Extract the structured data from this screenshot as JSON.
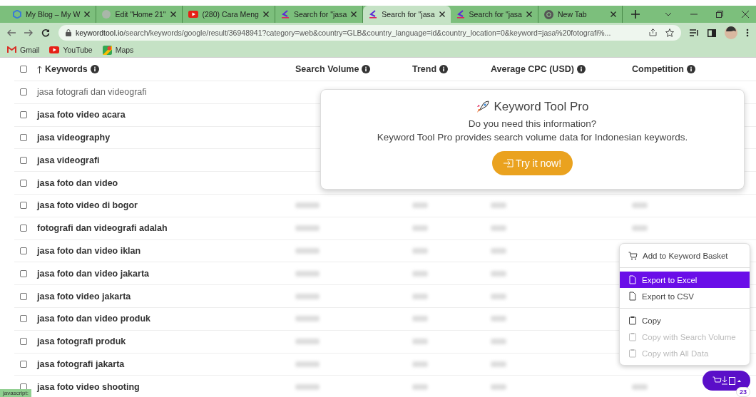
{
  "browser": {
    "tabs": [
      {
        "title": "My Blog – My W",
        "selected": false
      },
      {
        "title": "Edit \"Home 21\"",
        "selected": false
      },
      {
        "title": "(280) Cara Meng",
        "selected": false
      },
      {
        "title": "Search for \"jasa",
        "selected": false
      },
      {
        "title": "Search for \"jasa",
        "selected": true
      },
      {
        "title": "Search for \"jasa",
        "selected": false
      },
      {
        "title": "New Tab",
        "selected": false
      }
    ],
    "url_host": "keywordtool.io",
    "url_path": "/search/keywords/google/result/36948941?category=web&country=GLB&country_language=id&country_location=0&keyword=jasa%20fotografi%...",
    "bookmarks": [
      "Gmail",
      "YouTube",
      "Maps"
    ]
  },
  "table": {
    "select_all_checked": false,
    "columns": [
      "Keywords",
      "Search Volume",
      "Trend",
      "Average CPC (USD)",
      "Competition"
    ],
    "rows": [
      {
        "keyword": "jasa fotografi dan videografi",
        "kind": "seed",
        "checked": false,
        "values_blurred": false,
        "competition_blurred": false
      },
      {
        "keyword": "jasa foto video acara",
        "kind": "keyword",
        "checked": false,
        "values_blurred": false,
        "competition_blurred": false
      },
      {
        "keyword": "jasa videography",
        "kind": "keyword",
        "checked": false,
        "values_blurred": false,
        "competition_blurred": false
      },
      {
        "keyword": "jasa videografi",
        "kind": "keyword",
        "checked": false,
        "values_blurred": false,
        "competition_blurred": false
      },
      {
        "keyword": "jasa foto dan video",
        "kind": "keyword",
        "checked": false,
        "values_blurred": false,
        "competition_blurred": false
      },
      {
        "keyword": "jasa foto video di bogor",
        "kind": "keyword",
        "checked": false,
        "values_blurred": true,
        "competition_blurred": true
      },
      {
        "keyword": "fotografi dan videografi adalah",
        "kind": "keyword",
        "checked": false,
        "values_blurred": true,
        "competition_blurred": true
      },
      {
        "keyword": "jasa foto dan video iklan",
        "kind": "keyword",
        "checked": false,
        "values_blurred": true,
        "competition_blurred": false
      },
      {
        "keyword": "jasa foto dan video jakarta",
        "kind": "keyword",
        "checked": false,
        "values_blurred": true,
        "competition_blurred": false
      },
      {
        "keyword": "jasa foto video jakarta",
        "kind": "keyword",
        "checked": false,
        "values_blurred": true,
        "competition_blurred": false
      },
      {
        "keyword": "jasa foto dan video produk",
        "kind": "keyword",
        "checked": false,
        "values_blurred": true,
        "competition_blurred": false
      },
      {
        "keyword": "jasa fotografi produk",
        "kind": "keyword",
        "checked": false,
        "values_blurred": true,
        "competition_blurred": false
      },
      {
        "keyword": "jasa fotografi jakarta",
        "kind": "keyword",
        "checked": false,
        "values_blurred": true,
        "competition_blurred": false
      },
      {
        "keyword": "jasa foto video shooting",
        "kind": "keyword",
        "checked": false,
        "values_blurred": true,
        "competition_blurred": true
      }
    ]
  },
  "pro_popup": {
    "title": "Keyword Tool Pro",
    "question": "Do you need this information?",
    "text": "Keyword Tool Pro provides search volume data for Indonesian keywords.",
    "button": "Try it now!"
  },
  "export_menu": {
    "groups": [
      [
        {
          "label": "Add to Keyword Basket",
          "selected": false,
          "disabled": false
        }
      ],
      [
        {
          "label": "Export to Excel",
          "selected": true,
          "disabled": false
        },
        {
          "label": "Export to CSV",
          "selected": false,
          "disabled": false
        }
      ],
      [
        {
          "label": "Copy",
          "selected": false,
          "disabled": false
        },
        {
          "label": "Copy with Search Volume",
          "selected": false,
          "disabled": true
        },
        {
          "label": "Copy with All Data",
          "selected": false,
          "disabled": true
        }
      ]
    ]
  },
  "fab": {
    "count": "23"
  },
  "status_bar": "javascript:"
}
